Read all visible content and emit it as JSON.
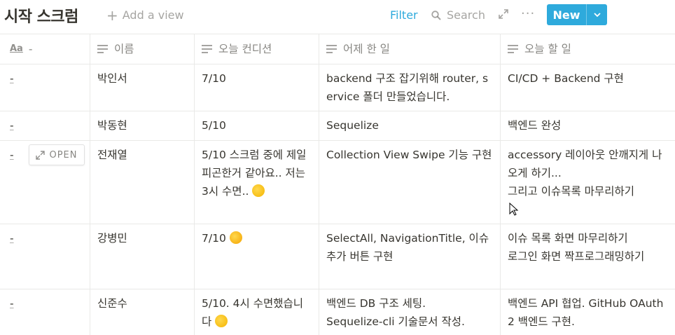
{
  "header": {
    "title": "시작 스크럼",
    "add_view": "Add a view",
    "filter": "Filter",
    "search": "Search",
    "more": "···",
    "new_label": "New"
  },
  "columns": [
    {
      "label": "-",
      "icon": "title-aa-icon"
    },
    {
      "label": "이름",
      "icon": "text-lines-icon"
    },
    {
      "label": "오늘 컨디션",
      "icon": "text-lines-icon"
    },
    {
      "label": "어제 한 일",
      "icon": "text-lines-icon"
    },
    {
      "label": "오늘 할 일",
      "icon": "text-lines-icon"
    }
  ],
  "rows": [
    {
      "title": "-",
      "name": "박인서",
      "condition": "7/10",
      "yesterday": "backend 구조 잡기위해 router, service 폴더 만들었습니다.",
      "today": "CI/CD + Backend 구현"
    },
    {
      "title": "-",
      "name": "박동현",
      "condition": "5/10",
      "yesterday": "Sequelize",
      "today": "백엔드 완성"
    },
    {
      "title": "-",
      "name": "전재열",
      "condition": "5/10 스크럼 중에 제일 피곤한거 같아요.. 저는 3시 수면..",
      "condition_emoji": "sweat-smile-emoji",
      "yesterday": "Collection View Swipe 기능 구현",
      "today_lines": [
        "accessory 레이아웃 안깨지게 나오게 하기...",
        "그리고 이슈목록 마무리하기"
      ]
    },
    {
      "title": "-",
      "name": "강병민",
      "condition": "7/10",
      "condition_emoji": "hug-emoji",
      "yesterday": "SelectAll,  NavigationTitle, 이슈 추가 버튼 구현",
      "today_lines": [
        "이슈 목록 화면 마무리하기",
        "로그인 화면 짝프로그래밍하기"
      ]
    },
    {
      "title": "-",
      "name": "신준수",
      "condition": "5/10. 4시 수면했습니다",
      "condition_emoji": "rofl-emoji",
      "yesterday_lines": [
        "백엔드 DB 구조 세팅.",
        "Sequelize-cli 기술문서 작성."
      ],
      "today": "백엔드 API 협업. GitHub OAuth2 백엔드 구현."
    }
  ],
  "open_button": "OPEN",
  "colors": {
    "accent": "#2eaadc",
    "text": "#37352f",
    "border": "#e9e9e7"
  }
}
